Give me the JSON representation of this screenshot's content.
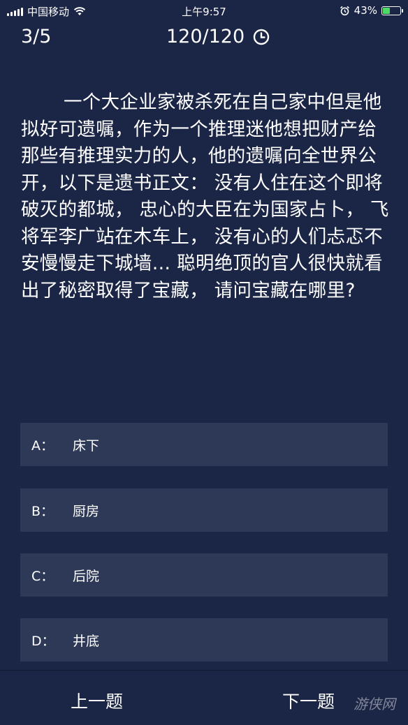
{
  "status_bar": {
    "carrier": "中国移动",
    "time": "上午9:57",
    "battery_percent": "43%",
    "battery_level": 0.43
  },
  "header": {
    "question_index": "3/5",
    "countdown": "120/120"
  },
  "question": {
    "text": "一个大企业家被杀死在自己家中但是他拟好可遗嘱，作为一个推理迷他想把财产给那些有推理实力的人，他的遗嘱向全世界公开，以下是遗书正文： 没有人住在这个即将破灭的都城， 忠心的大臣在为国家占卜， 飞将军李广站在木车上， 没有心的人们忐忑不安慢慢走下城墙… 聪明绝顶的官人很快就看出了秘密取得了宝藏， 请问宝藏在哪里?"
  },
  "options": [
    {
      "letter": "A：",
      "text": "床下"
    },
    {
      "letter": "B：",
      "text": "厨房"
    },
    {
      "letter": "C：",
      "text": "后院"
    },
    {
      "letter": "D：",
      "text": "井底"
    }
  ],
  "footer": {
    "prev_label": "上一题",
    "next_label": "下一题",
    "watermark": "游侠网"
  },
  "colors": {
    "background": "#1b2545",
    "option_background": "#2d3957",
    "battery_fill": "#4cd964"
  }
}
